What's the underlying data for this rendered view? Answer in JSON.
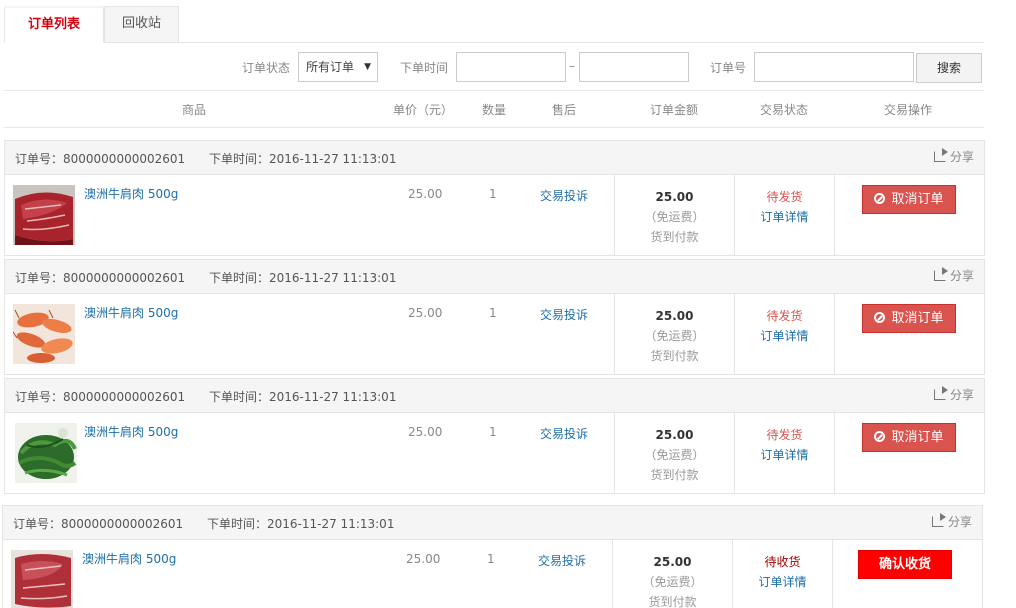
{
  "tabs": [
    {
      "label": "订单列表",
      "active": true
    },
    {
      "label": "回收站",
      "active": false
    }
  ],
  "filter": {
    "status_label": "订单状态",
    "status_value": "所有订单",
    "time_label": "下单时间",
    "date_from": "",
    "date_to": "",
    "dash": "–",
    "orderno_label": "订单号",
    "orderno_value": "",
    "search_label": "搜索"
  },
  "columns": {
    "product": "商品",
    "price": "单价（元）",
    "qty": "数量",
    "aftersale": "售后",
    "amount": "订单金额",
    "status": "交易状态",
    "action": "交易操作"
  },
  "share_label": "分享",
  "colors": {
    "accent": "#d7000f",
    "cancel": "#d9534f",
    "confirm": "#ff0000",
    "link": "#1d6ea8"
  },
  "orders": [
    {
      "order_no": "订单号：8000000000002601",
      "order_time": "下单时间：2016-11-27 11:13:01",
      "thumb": "beef",
      "product": "澳洲牛肩肉 500g",
      "price": "25.00",
      "qty": "1",
      "aftersale": "交易投诉",
      "amount": "25.00",
      "shipping": "（免运费）",
      "payment": "货到付款",
      "status": "待发货",
      "detail": "订单详情",
      "action": "取消订单",
      "action_type": "cancel"
    },
    {
      "order_no": "订单号：8000000000002601",
      "order_time": "下单时间：2016-11-27 11:13:01",
      "thumb": "shrimp",
      "product": "澳洲牛肩肉 500g",
      "price": "25.00",
      "qty": "1",
      "aftersale": "交易投诉",
      "amount": "25.00",
      "shipping": "（免运费）",
      "payment": "货到付款",
      "status": "待发货",
      "detail": "订单详情",
      "action": "取消订单",
      "action_type": "cancel"
    },
    {
      "order_no": "订单号：8000000000002601",
      "order_time": "下单时间：2016-11-27 11:13:01",
      "thumb": "greens",
      "product": "澳洲牛肩肉 500g",
      "price": "25.00",
      "qty": "1",
      "aftersale": "交易投诉",
      "amount": "25.00",
      "shipping": "（免运费）",
      "payment": "货到付款",
      "status": "待发货",
      "detail": "订单详情",
      "action": "取消订单",
      "action_type": "cancel"
    },
    {
      "order_no": "订单号：8000000000002601",
      "order_time": "下单时间：2016-11-27 11:13:01",
      "thumb": "beef",
      "product": "澳洲牛肩肉 500g",
      "price": "25.00",
      "qty": "1",
      "aftersale": "交易投诉",
      "amount": "25.00",
      "shipping": "（免运费）",
      "payment": "货到付款",
      "status": "待收货",
      "detail": "订单详情",
      "action": "确认收货",
      "action_type": "confirm"
    }
  ]
}
